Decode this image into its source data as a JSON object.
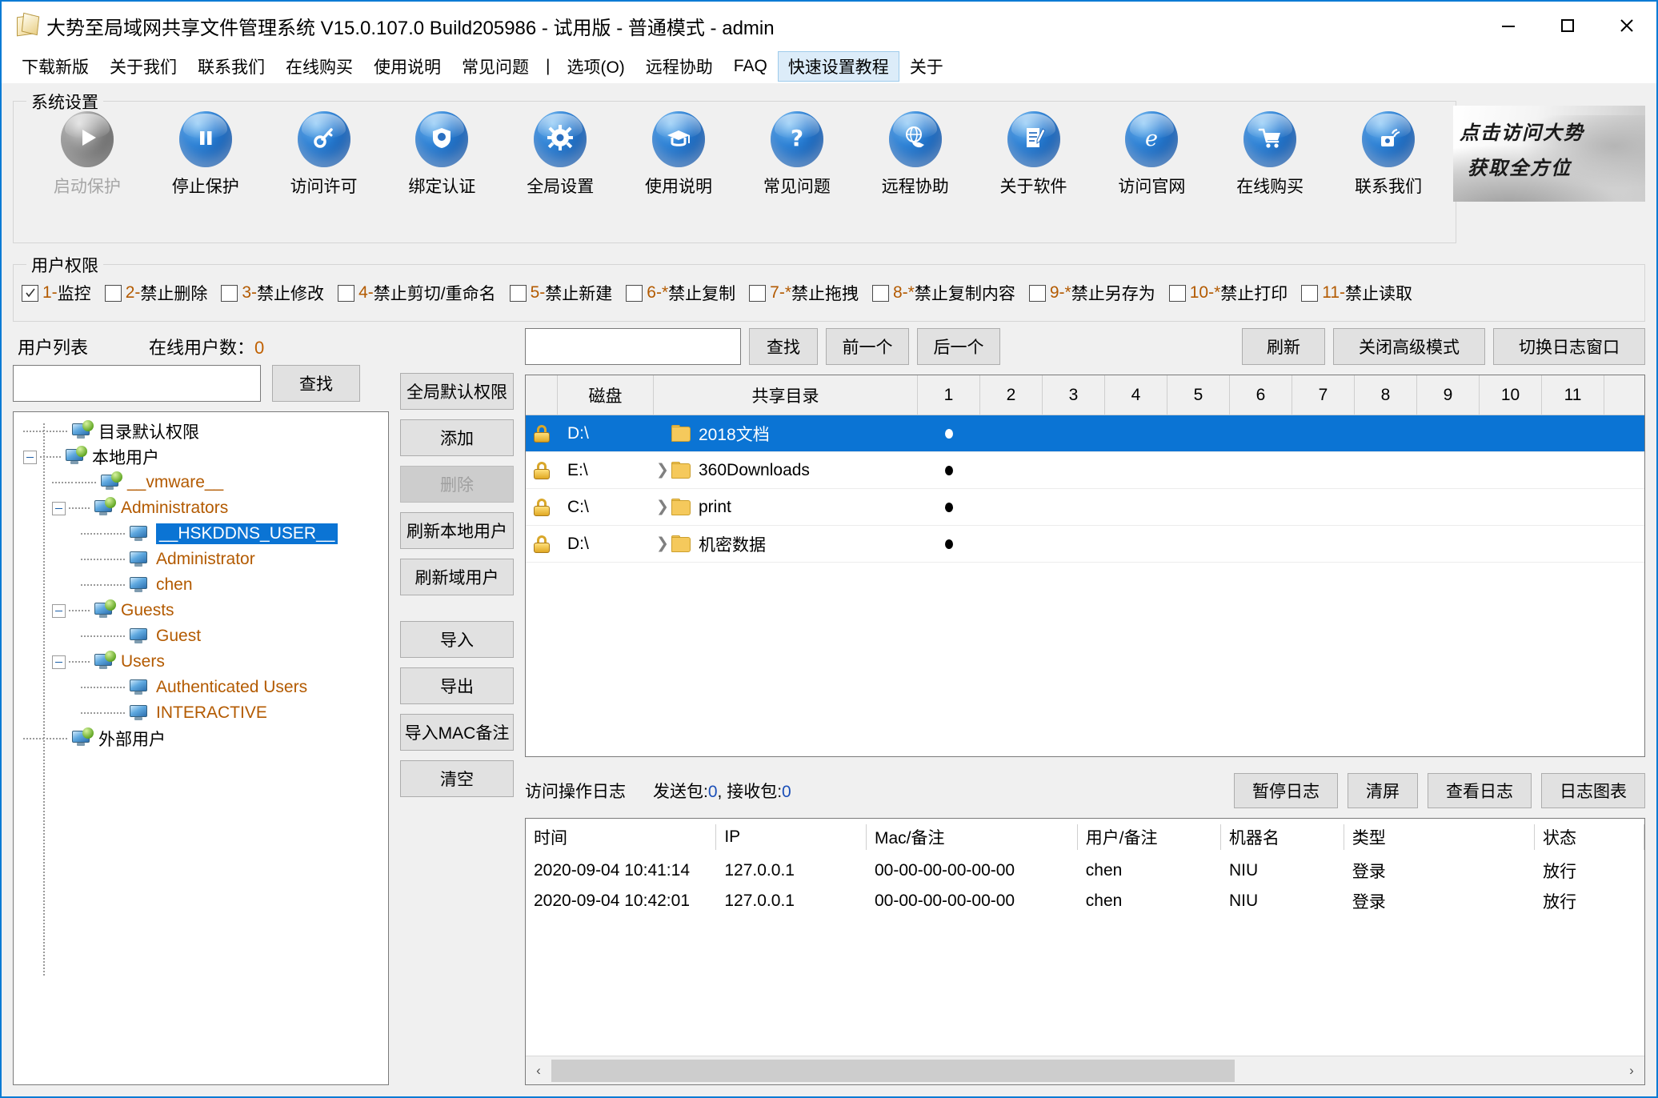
{
  "window": {
    "title": "大势至局域网共享文件管理系统 V15.0.107.0 Build205986 - 试用版 - 普通模式 - admin",
    "minimize": "−",
    "maximize": "□",
    "close": "✕"
  },
  "menu": {
    "items": [
      {
        "label": "下载新版",
        "highlight": false
      },
      {
        "label": "关于我们",
        "highlight": false
      },
      {
        "label": "联系我们",
        "highlight": false
      },
      {
        "label": "在线购买",
        "highlight": false
      },
      {
        "label": "使用说明",
        "highlight": false
      },
      {
        "label": "常见问题",
        "highlight": false
      },
      {
        "label": "|",
        "highlight": false
      },
      {
        "label": "选项(O)",
        "highlight": false
      },
      {
        "label": "远程协助",
        "highlight": false
      },
      {
        "label": "FAQ",
        "highlight": false
      },
      {
        "label": "快速设置教程",
        "highlight": true
      },
      {
        "label": "关于",
        "highlight": false
      }
    ]
  },
  "system_settings": {
    "group_title": "系统设置",
    "buttons": [
      {
        "label": "启动保护",
        "icon": "play-icon",
        "disabled": true
      },
      {
        "label": "停止保护",
        "icon": "pause-icon",
        "disabled": false
      },
      {
        "label": "访问许可",
        "icon": "key-icon",
        "disabled": false
      },
      {
        "label": "绑定认证",
        "icon": "shield-icon",
        "disabled": false
      },
      {
        "label": "全局设置",
        "icon": "gear-icon",
        "disabled": false
      },
      {
        "label": "使用说明",
        "icon": "graduation-cap-icon",
        "disabled": false
      },
      {
        "label": "常见问题",
        "icon": "question-mark-icon",
        "disabled": false
      },
      {
        "label": "远程协助",
        "icon": "globe-hand-icon",
        "disabled": false
      },
      {
        "label": "关于软件",
        "icon": "document-pen-icon",
        "disabled": false
      },
      {
        "label": "访问官网",
        "icon": "ie-browser-icon",
        "disabled": false
      },
      {
        "label": "在线购买",
        "icon": "shopping-cart-icon",
        "disabled": false
      },
      {
        "label": "联系我们",
        "icon": "telephone-icon",
        "disabled": false
      }
    ]
  },
  "banner": {
    "line1": "点击访问大势",
    "line2": "获取全方位"
  },
  "permissions": {
    "group_title": "用户权限",
    "items": [
      {
        "num": "1-",
        "label": "监控",
        "checked": true
      },
      {
        "num": "2-",
        "label": "禁止删除",
        "checked": false
      },
      {
        "num": "3-",
        "label": "禁止修改",
        "checked": false
      },
      {
        "num": "4-",
        "label": "禁止剪切/重命名",
        "checked": false
      },
      {
        "num": "5-",
        "label": "禁止新建",
        "checked": false
      },
      {
        "num": "6-*",
        "label": "禁止复制",
        "checked": false
      },
      {
        "num": "7-*",
        "label": "禁止拖拽",
        "checked": false
      },
      {
        "num": "8-*",
        "label": "禁止复制内容",
        "checked": false
      },
      {
        "num": "9-*",
        "label": "禁止另存为",
        "checked": false
      },
      {
        "num": "10-*",
        "label": "禁止打印",
        "checked": false
      },
      {
        "num": "11-",
        "label": "禁止读取",
        "checked": false
      }
    ]
  },
  "user_list": {
    "title": "用户列表",
    "online_label": "在线用户数：",
    "online_count": "0",
    "search_value": "",
    "search_button": "查找",
    "tree": [
      {
        "label": "目录默认权限",
        "level": 0,
        "type": "group",
        "expander": "",
        "color": "black",
        "selected": false
      },
      {
        "label": "本地用户",
        "level": 0,
        "type": "group",
        "expander": "-",
        "color": "black",
        "selected": false
      },
      {
        "label": "__vmware__",
        "level": 1,
        "type": "group",
        "expander": "",
        "color": "brown",
        "selected": false
      },
      {
        "label": "Administrators",
        "level": 1,
        "type": "group",
        "expander": "-",
        "color": "brown",
        "selected": false
      },
      {
        "label": "__HSKDDNS_USER__",
        "level": 2,
        "type": "user",
        "expander": "",
        "color": "sel",
        "selected": true
      },
      {
        "label": "Administrator",
        "level": 2,
        "type": "user",
        "expander": "",
        "color": "brown",
        "selected": false
      },
      {
        "label": "chen",
        "level": 2,
        "type": "user",
        "expander": "",
        "color": "brown",
        "selected": false
      },
      {
        "label": "Guests",
        "level": 1,
        "type": "group",
        "expander": "-",
        "color": "brown",
        "selected": false
      },
      {
        "label": "Guest",
        "level": 2,
        "type": "user",
        "expander": "",
        "color": "brown",
        "selected": false
      },
      {
        "label": "Users",
        "level": 1,
        "type": "group",
        "expander": "-",
        "color": "brown",
        "selected": false
      },
      {
        "label": "Authenticated Users",
        "level": 2,
        "type": "user",
        "expander": "",
        "color": "brown",
        "selected": false
      },
      {
        "label": "INTERACTIVE",
        "level": 2,
        "type": "user",
        "expander": "",
        "color": "brown",
        "selected": false
      },
      {
        "label": "外部用户",
        "level": 0,
        "type": "group",
        "expander": "",
        "color": "black",
        "selected": false
      }
    ]
  },
  "mid_buttons": [
    {
      "label": "全局默认权限",
      "disabled": false,
      "gap": false
    },
    {
      "label": "添加",
      "disabled": false,
      "gap": false
    },
    {
      "label": "删除",
      "disabled": true,
      "gap": false
    },
    {
      "label": "刷新本地用户",
      "disabled": false,
      "gap": false
    },
    {
      "label": "刷新域用户",
      "disabled": false,
      "gap": false
    },
    {
      "label": "导入",
      "disabled": false,
      "gap": true
    },
    {
      "label": "导出",
      "disabled": false,
      "gap": false
    },
    {
      "label": "导入MAC备注",
      "disabled": false,
      "gap": false
    },
    {
      "label": "清空",
      "disabled": false,
      "gap": false
    }
  ],
  "share_toolbar": {
    "search_value": "",
    "find_button": "查找",
    "prev_button": "前一个",
    "next_button": "后一个",
    "refresh_button": "刷新",
    "advanced_button": "关闭高级模式",
    "switch_log_button": "切换日志窗口"
  },
  "share_grid": {
    "headers": {
      "disk": "磁盘",
      "dir": "共享目录",
      "perm_cols": [
        "1",
        "2",
        "3",
        "4",
        "5",
        "6",
        "7",
        "8",
        "9",
        "10",
        "11"
      ]
    },
    "rows": [
      {
        "disk": "D:\\",
        "dir": "2018文档",
        "chevron": false,
        "selected": true,
        "marks": [
          true,
          false,
          false,
          false,
          false,
          false,
          false,
          false,
          false,
          false,
          false
        ]
      },
      {
        "disk": "E:\\",
        "dir": "360Downloads",
        "chevron": true,
        "selected": false,
        "marks": [
          true,
          false,
          false,
          false,
          false,
          false,
          false,
          false,
          false,
          false,
          false
        ]
      },
      {
        "disk": "C:\\",
        "dir": "print",
        "chevron": true,
        "selected": false,
        "marks": [
          true,
          false,
          false,
          false,
          false,
          false,
          false,
          false,
          false,
          false,
          false
        ]
      },
      {
        "disk": "D:\\",
        "dir": "机密数据",
        "chevron": true,
        "selected": false,
        "marks": [
          true,
          false,
          false,
          false,
          false,
          false,
          false,
          false,
          false,
          false,
          false
        ]
      }
    ]
  },
  "log_panel": {
    "title": "访问操作日志",
    "packets_sent_label": "发送包:",
    "packets_sent": "0",
    "packets_recv_label": "接收包:",
    "packets_recv": "0",
    "buttons": [
      {
        "label": "暂停日志"
      },
      {
        "label": "清屏"
      },
      {
        "label": "查看日志"
      },
      {
        "label": "日志图表"
      }
    ],
    "headers": [
      "时间",
      "IP",
      "Mac/备注",
      "用户/备注",
      "机器名",
      "类型",
      "状态"
    ],
    "rows": [
      {
        "time": "2020-09-04 10:41:14",
        "ip": "127.0.0.1",
        "mac": "00-00-00-00-00-00",
        "user": "chen",
        "machine": "NIU",
        "type": "登录",
        "status": "放行"
      },
      {
        "time": "2020-09-04 10:42:01",
        "ip": "127.0.0.1",
        "mac": "00-00-00-00-00-00",
        "user": "chen",
        "machine": "NIU",
        "type": "登录",
        "status": "放行"
      }
    ],
    "scroll_left": "‹",
    "scroll_right": "›"
  },
  "colors": {
    "accent": "#0b74d4",
    "title_border": "#0a7bd4",
    "brown_text": "#b35a00",
    "menu_highlight_bg": "#dcecf9"
  }
}
